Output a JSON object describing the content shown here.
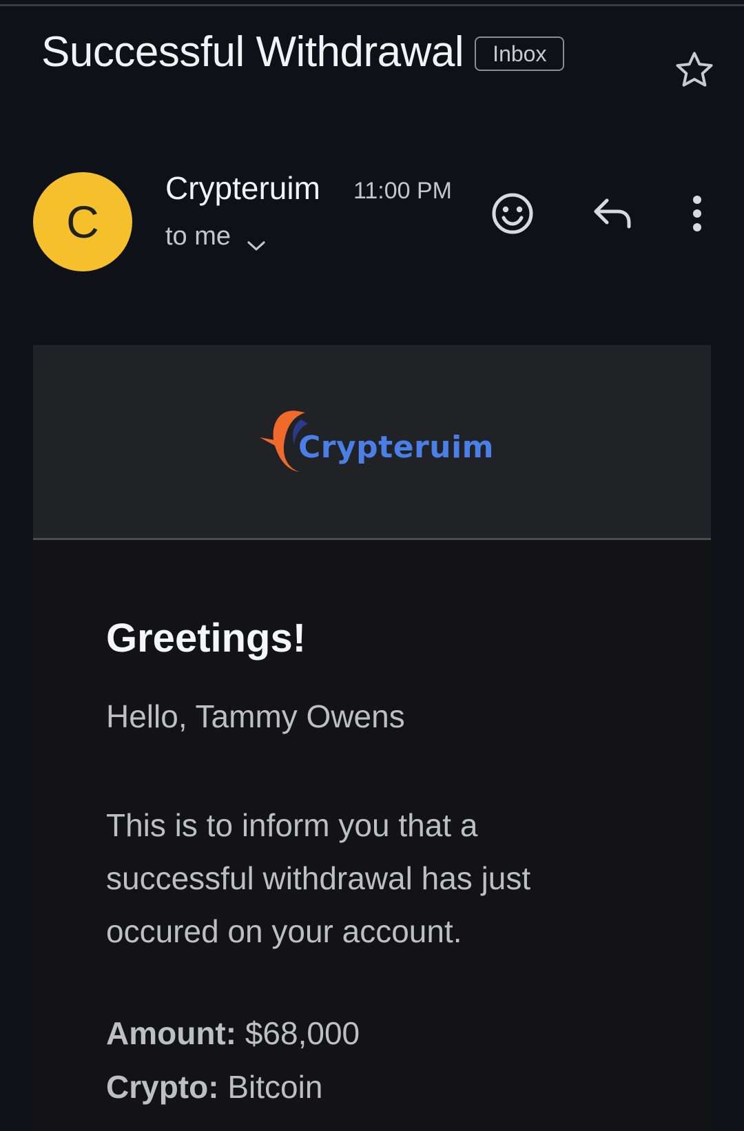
{
  "subject": "Successful Withdrawal",
  "label": "Inbox",
  "sender": {
    "avatar_initial": "C",
    "avatar_color": "#f6c02d",
    "name": "Crypteruim",
    "time": "11:00 PM",
    "recipient": "to me"
  },
  "icons": [
    "star-icon",
    "emoji-icon",
    "reply-icon",
    "more-vert-icon",
    "chevron-down-icon"
  ],
  "email": {
    "logo_text": "Crypteruim",
    "greeting": "Greetings!",
    "salutation": "Hello, Tammy Owens",
    "message": "This is to inform you that a successful withdrawal has just occured on your account.",
    "details": [
      {
        "label": "Amount:",
        "value": "$68,000"
      },
      {
        "label": "Crypto:",
        "value": "Bitcoin"
      }
    ]
  },
  "colors": {
    "background": "#0e1218",
    "email_header": "#212226",
    "email_body": "#131315",
    "logo_blue": "#4b7fe8",
    "logo_orange": "#f06a2c"
  }
}
